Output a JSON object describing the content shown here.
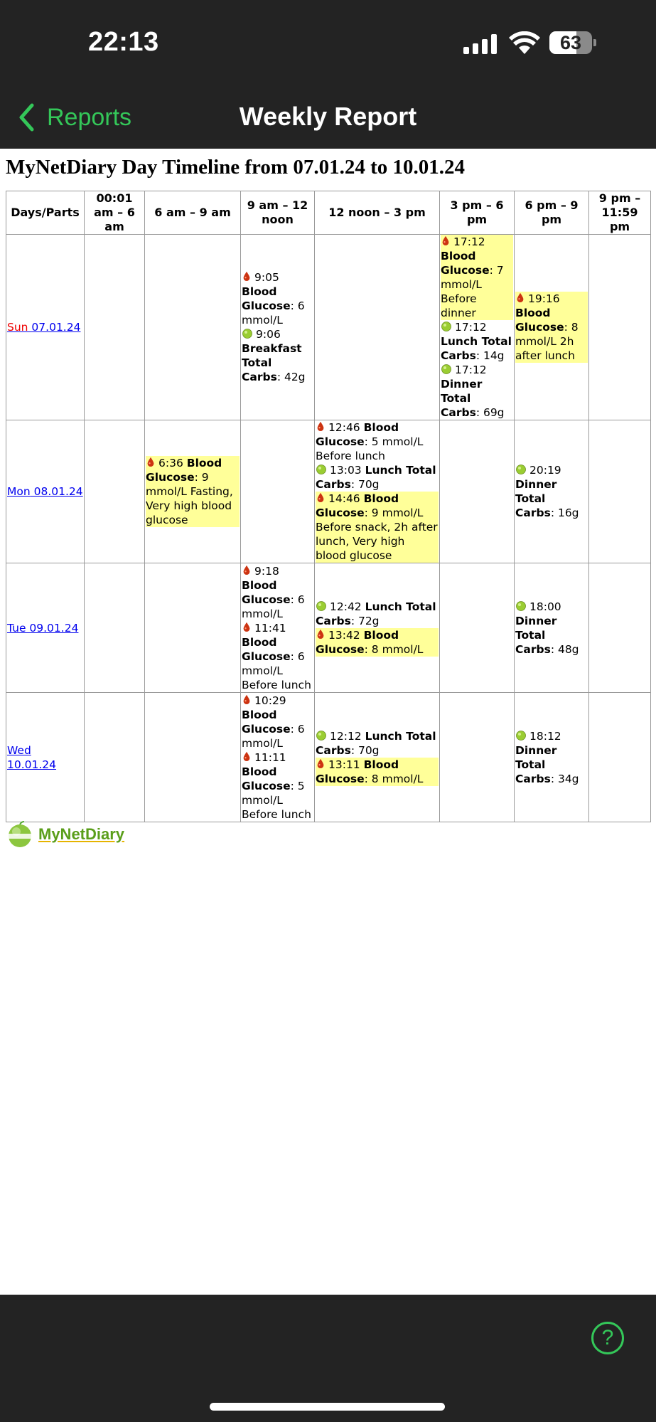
{
  "status": {
    "time": "22:13",
    "battery": "63",
    "battery_level": 0.63
  },
  "nav": {
    "back_label": "Reports",
    "title": "Weekly Report"
  },
  "report": {
    "title": "MyNetDiary Day Timeline from 07.01.24 to 10.01.24",
    "columns": [
      "Days/Parts",
      "00:01 am – 6 am",
      "6 am – 9 am",
      "9 am – 12 noon",
      "12 noon – 3 pm",
      "3 pm – 6 pm",
      "6 pm – 9 pm",
      "9 pm – 11:59 pm"
    ],
    "rows": [
      {
        "day_prefix": "Sun",
        "day_date": " 07.01.24",
        "cells": [
          [],
          [],
          [
            {
              "icon": "blood-drop-icon",
              "time": "9:05",
              "bold": "Blood Glucose",
              "rest": ": 6 mmol/L",
              "highlight": false
            },
            {
              "icon": "apple-icon",
              "time": "9:06",
              "bold": "Breakfast Total Carbs",
              "rest": ": 42g",
              "highlight": false
            }
          ],
          [],
          [
            {
              "icon": "blood-drop-icon",
              "time": "17:12",
              "bold": "Blood Glucose",
              "rest": ": 7 mmol/L Before dinner",
              "highlight": true
            },
            {
              "icon": "apple-icon",
              "time": "17:12",
              "bold": "Lunch Total Carbs",
              "rest": ": 14g",
              "highlight": false
            },
            {
              "icon": "apple-icon",
              "time": "17:12",
              "bold": "Dinner Total Carbs",
              "rest": ": 69g",
              "highlight": false
            }
          ],
          [
            {
              "icon": "blood-drop-icon",
              "time": "19:16",
              "bold": "Blood Glucose",
              "rest": ": 8 mmol/L 2h after lunch",
              "highlight": true
            }
          ],
          []
        ]
      },
      {
        "day_prefix": "Mon",
        "day_date": " 08.01.24",
        "cells": [
          [],
          [
            {
              "icon": "blood-drop-icon",
              "time": "6:36",
              "bold": "Blood Glucose",
              "rest": ": 9 mmol/L Fasting, Very high blood glucose",
              "highlight": true
            }
          ],
          [],
          [
            {
              "icon": "blood-drop-icon",
              "time": "12:46",
              "bold": "Blood Glucose",
              "rest": ": 5 mmol/L Before lunch",
              "highlight": false
            },
            {
              "icon": "apple-icon",
              "time": "13:03",
              "bold": "Lunch Total Carbs",
              "rest": ": 70g",
              "highlight": false
            },
            {
              "icon": "blood-drop-icon",
              "time": "14:46",
              "bold": "Blood Glucose",
              "rest": ": 9 mmol/L Before snack, 2h after lunch, Very high blood glucose",
              "highlight": true
            }
          ],
          [],
          [
            {
              "icon": "apple-icon",
              "time": "20:19",
              "bold": "Dinner Total Carbs",
              "rest": ": 16g",
              "highlight": false
            }
          ],
          []
        ]
      },
      {
        "day_prefix": "Tue",
        "day_date": " 09.01.24",
        "cells": [
          [],
          [],
          [
            {
              "icon": "blood-drop-icon",
              "time": "9:18",
              "bold": "Blood Glucose",
              "rest": ": 6 mmol/L",
              "highlight": false
            },
            {
              "icon": "blood-drop-icon",
              "time": "11:41",
              "bold": "Blood Glucose",
              "rest": ": 6 mmol/L Before lunch",
              "highlight": false
            }
          ],
          [
            {
              "icon": "apple-icon",
              "time": "12:42",
              "bold": "Lunch Total Carbs",
              "rest": ": 72g",
              "highlight": false
            },
            {
              "icon": "blood-drop-icon",
              "time": "13:42",
              "bold": "Blood Glucose",
              "rest": ": 8 mmol/L",
              "highlight": true
            }
          ],
          [],
          [
            {
              "icon": "apple-icon",
              "time": "18:00",
              "bold": "Dinner Total Carbs",
              "rest": ": 48g",
              "highlight": false
            }
          ],
          []
        ]
      },
      {
        "day_prefix": "Wed",
        "day_date": " 10.01.24",
        "cells": [
          [],
          [],
          [
            {
              "icon": "blood-drop-icon",
              "time": "10:29",
              "bold": "Blood Glucose",
              "rest": ": 6 mmol/L",
              "highlight": false
            },
            {
              "icon": "blood-drop-icon",
              "time": "11:11",
              "bold": "Blood Glucose",
              "rest": ": 5 mmol/L Before lunch",
              "highlight": false
            }
          ],
          [
            {
              "icon": "apple-icon",
              "time": "12:12",
              "bold": "Lunch Total Carbs",
              "rest": ": 70g",
              "highlight": false
            },
            {
              "icon": "blood-drop-icon",
              "time": "13:11",
              "bold": "Blood Glucose",
              "rest": ": 8 mmol/L",
              "highlight": true
            }
          ],
          [],
          [
            {
              "icon": "apple-icon",
              "time": "18:12",
              "bold": "Dinner Total Carbs",
              "rest": ": 34g",
              "highlight": false
            }
          ],
          []
        ]
      }
    ]
  },
  "logo": {
    "text": "MyNetDiary"
  },
  "help": {
    "icon": "help-icon",
    "glyph": "?"
  },
  "colors": {
    "accent": "#34c759",
    "highlight": "#ffff99",
    "link": "#0000ee",
    "sunday": "#ee0000"
  }
}
